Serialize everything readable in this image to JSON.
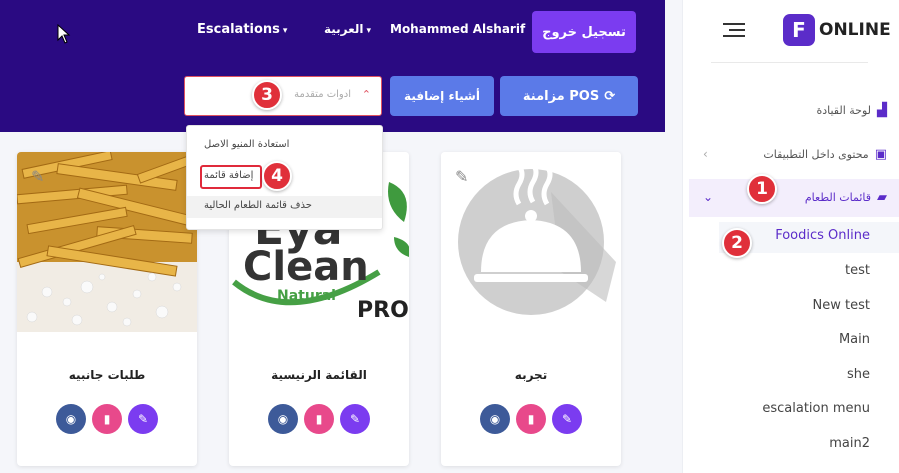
{
  "header": {
    "escalations": "Escalations",
    "language": "العربية",
    "user_name": "Mohammed Alsharif",
    "logout_label": "تسجيل خروج",
    "pos_sync_label": "مزامنة POS",
    "extras_label": "أشياء إضافية",
    "tools_placeholder": "ادوات متقدمة"
  },
  "dropdown": {
    "items": [
      "استعادة المنيو الاصل",
      "إضافة قائمة",
      "حذف قائمة الطعام الحالية"
    ]
  },
  "badges": [
    "1",
    "2",
    "3",
    "4"
  ],
  "sidebar": {
    "logo_text": "ONLINE",
    "items": [
      {
        "label": "لوحة القيادة",
        "icon": "chart-icon"
      },
      {
        "label": "محتوى داخل التطبيقات",
        "icon": "images-icon"
      },
      {
        "label": "قائمات الطعام",
        "icon": "book-icon"
      }
    ],
    "submenu": [
      "Foodics Online",
      "test",
      "New test",
      "Main",
      "she",
      "escalation menu",
      "main2"
    ]
  },
  "cards": [
    {
      "title": "طلبات جانبيه",
      "image": "fries-photo"
    },
    {
      "title": "القائمة الرنيسية",
      "image": "eya-clean-logo",
      "logo_lines": [
        "Eya",
        "Clean",
        "Natural",
        "PRO"
      ]
    },
    {
      "title": "تجربه",
      "image": "cloche-placeholder"
    }
  ],
  "colors": {
    "header_bg": "#2a0a82",
    "accent_purple": "#7b3cf0",
    "button_blue": "#5b7ae8",
    "badge_red": "#e0303a"
  }
}
